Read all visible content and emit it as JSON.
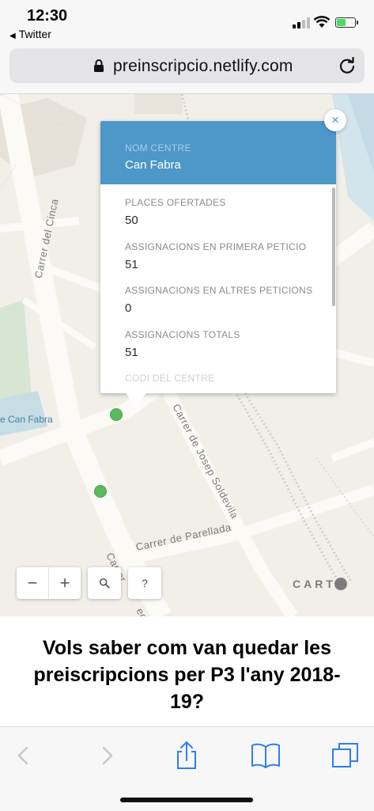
{
  "status_bar": {
    "time": "12:30",
    "back_app": "Twitter",
    "battery_fill_fraction": 0.5,
    "battery_color": "#4cd964"
  },
  "browser": {
    "url": "preinscripcio.netlify.com",
    "lock_icon": "lock-icon",
    "reload_icon": "reload-icon"
  },
  "map": {
    "streets": [
      "Carrer del Cinca",
      "Carrer de Josep Soldevila",
      "Carrer de Parellada",
      "Carrer",
      "egre"
    ],
    "poi": "e Can Fabra",
    "marker_color": "#5bbb5c",
    "popup": {
      "header_color": "#4d97c9",
      "nom_centre_label": "NOM CENTRE",
      "nom_centre_value": "Can Fabra",
      "fields": [
        {
          "label": "PLACES OFERTADES",
          "value": "50"
        },
        {
          "label": "ASSIGNACIONS EN PRIMERA PETICIO",
          "value": "51"
        },
        {
          "label": "ASSIGNACIONS EN ALTRES PETICIONS",
          "value": "0"
        },
        {
          "label": "ASSIGNACIONS TOTALS",
          "value": "51"
        },
        {
          "label": "CODI DEL CENTRE",
          "value": ""
        }
      ],
      "close_label": "×"
    },
    "controls": {
      "zoom_out": "−",
      "zoom_in": "+",
      "search_icon": "search-icon",
      "help": "?"
    },
    "attribution": "CART"
  },
  "page": {
    "headline": "Vols saber com van quedar les preiscripcions per P3 l'any 2018-19?"
  },
  "toolbar": {
    "icons": [
      "back-icon",
      "forward-icon",
      "share-icon",
      "bookmarks-icon",
      "tabs-icon"
    ],
    "accent_color": "#2f7cf6"
  }
}
